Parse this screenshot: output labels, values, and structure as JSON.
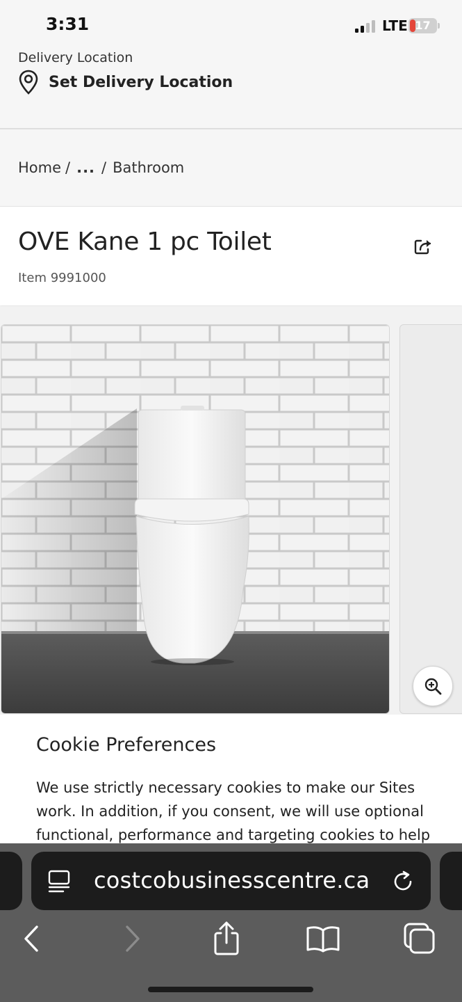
{
  "status_bar": {
    "time": "3:31",
    "network": "LTE",
    "battery_percent": 17
  },
  "delivery": {
    "label": "Delivery Location",
    "link_text": "Set Delivery Location",
    "icon": "location-pin-icon"
  },
  "breadcrumb": {
    "items": [
      "Home",
      "...",
      "Bathroom"
    ],
    "separator": "/"
  },
  "product": {
    "title": "OVE Kane 1 pc Toilet",
    "item_number": "Item 9991000"
  },
  "cookie": {
    "title": "Cookie Preferences",
    "text": "We use strictly necessary cookies to make our Sites work. In addition, if you consent, we will use optional functional, performance and targeting cookies to help"
  },
  "browser": {
    "url": "costcobusinesscentre.ca",
    "toolbar_icons": [
      "back-icon",
      "forward-icon",
      "share-icon",
      "bookmarks-icon",
      "tabs-icon"
    ]
  },
  "colors": {
    "battery_low": "#e4453a",
    "safari_toolbar": "#5c5c5c",
    "address_bar": "#1c1c1c"
  }
}
